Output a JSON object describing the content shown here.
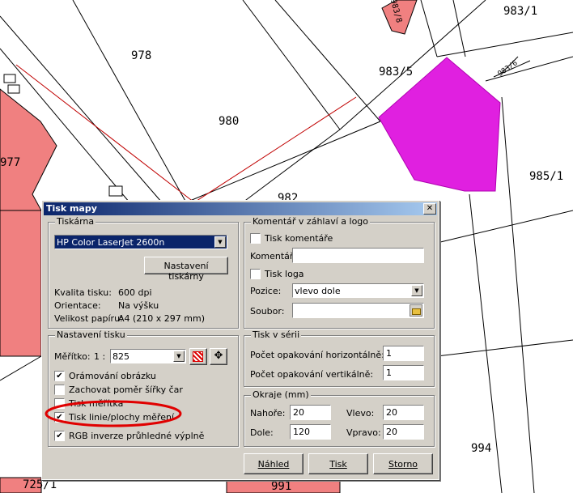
{
  "map": {
    "parcel_labels": [
      "983/8",
      "983/1",
      "978",
      "983/5",
      "983/6",
      "980",
      "977",
      "985/1",
      "982",
      "994",
      "725/1",
      "991"
    ]
  },
  "dialog": {
    "title": "Tisk mapy",
    "close_glyph": "✕",
    "printer_group": {
      "legend": "Tiskárna",
      "printer_selected": "HP Color LaserJet 2600n",
      "settings_button": "Nastavení tiskárny",
      "quality_label": "Kvalita tisku:",
      "quality_value": "600 dpi",
      "orientation_label": "Orientace:",
      "orientation_value": "Na výšku",
      "paper_label": "Velikost papíru:",
      "paper_value": "A4 (210 x 297 mm)"
    },
    "print_settings": {
      "legend": "Nastavení tisku",
      "scale_label": "Měřítko:",
      "scale_prefix": "1 :",
      "scale_value": "825",
      "options": [
        {
          "label": "Orámování obrázku",
          "checked": true
        },
        {
          "label": "Zachovat poměr šířky čar",
          "checked": false
        },
        {
          "label": "Tisk měřítka",
          "checked": false
        },
        {
          "label": "Tisk linie/plochy měření",
          "checked": true
        },
        {
          "label": "RGB inverze průhledné výplně",
          "checked": true
        }
      ]
    },
    "comment_group": {
      "legend": "Komentář v záhlaví a logo",
      "print_comment_label": "Tisk komentáře",
      "comment_label": "Komentář:",
      "comment_value": "",
      "print_logo_label": "Tisk loga",
      "position_label": "Pozice:",
      "position_value": "vlevo dole",
      "file_label": "Soubor:",
      "file_value": ""
    },
    "series_group": {
      "legend": "Tisk v sérii",
      "horizontal_label": "Počet opakování horizontálně:",
      "horizontal_value": "1",
      "vertical_label": "Počet opakování vertikálně:",
      "vertical_value": "1"
    },
    "margins_group": {
      "legend": "Okraje (mm)",
      "top_label": "Nahoře:",
      "top_value": "20",
      "left_label": "Vlevo:",
      "left_value": "20",
      "bottom_label": "Dole:",
      "bottom_value": "120",
      "right_label": "Vpravo:",
      "right_value": "20"
    },
    "buttons": {
      "preview": "Náhled",
      "print": "Tisk",
      "cancel": "Storno"
    }
  },
  "colors": {
    "parcel_red": "#f08080",
    "parcel_magenta": "#e020e0",
    "annotation_red": "#e00000"
  }
}
